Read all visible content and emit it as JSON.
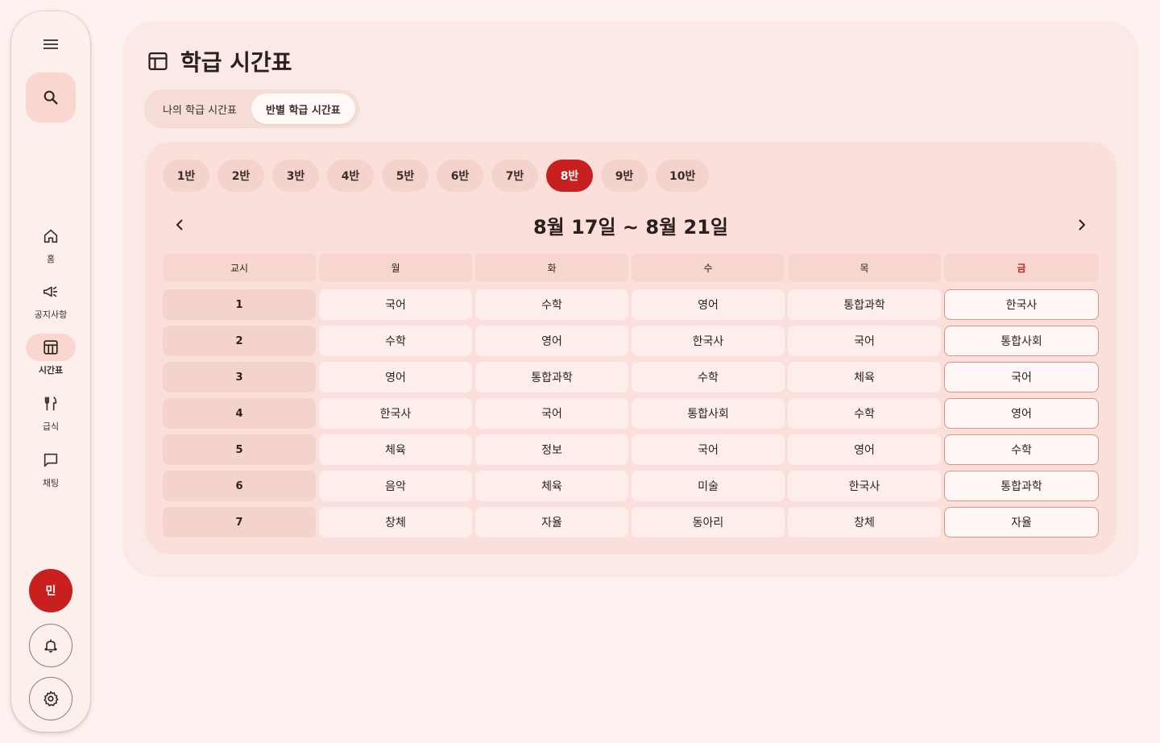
{
  "sidebar": {
    "items": [
      {
        "label": "홈",
        "icon": "home-icon"
      },
      {
        "label": "공지사항",
        "icon": "megaphone-icon"
      },
      {
        "label": "시간표",
        "icon": "timetable-icon",
        "active": true
      },
      {
        "label": "급식",
        "icon": "utensils-icon"
      },
      {
        "label": "채팅",
        "icon": "chat-icon"
      }
    ],
    "avatar_initial": "민"
  },
  "header": {
    "title": "학급 시간표"
  },
  "segments": [
    {
      "label": "나의 학급 시간표",
      "active": false
    },
    {
      "label": "반별 학급 시간표",
      "active": true
    }
  ],
  "classes": [
    "1반",
    "2반",
    "3반",
    "4반",
    "5반",
    "6반",
    "7반",
    "8반",
    "9반",
    "10반"
  ],
  "selected_class": "8반",
  "week": {
    "range": "8월 17일 ~ 8월 21일"
  },
  "timetable": {
    "headers": [
      "교시",
      "월",
      "화",
      "수",
      "목",
      "금"
    ],
    "today_index": 5,
    "rows": [
      {
        "period": "1",
        "subjects": [
          "국어",
          "수학",
          "영어",
          "통합과학",
          "한국사"
        ]
      },
      {
        "period": "2",
        "subjects": [
          "수학",
          "영어",
          "한국사",
          "국어",
          "통합사회"
        ]
      },
      {
        "period": "3",
        "subjects": [
          "영어",
          "통합과학",
          "수학",
          "체육",
          "국어"
        ]
      },
      {
        "period": "4",
        "subjects": [
          "한국사",
          "국어",
          "통합사회",
          "수학",
          "영어"
        ]
      },
      {
        "period": "5",
        "subjects": [
          "체육",
          "정보",
          "국어",
          "영어",
          "수학"
        ]
      },
      {
        "period": "6",
        "subjects": [
          "음악",
          "체육",
          "미술",
          "한국사",
          "통합과학"
        ]
      },
      {
        "period": "7",
        "subjects": [
          "창체",
          "자율",
          "동아리",
          "창체",
          "자율"
        ]
      }
    ]
  },
  "colors": {
    "accent": "#c7201e",
    "background": "#fdf2ef",
    "panel": "#fbe9e5"
  }
}
